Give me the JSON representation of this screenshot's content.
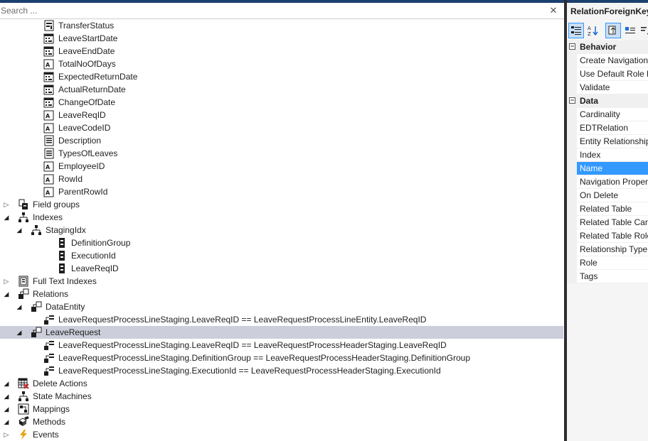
{
  "search": {
    "placeholder": "Search ...",
    "close_glyph": "✕"
  },
  "tree": {
    "fields": [
      "TransferStatus",
      "LeaveStartDate",
      "LeaveEndDate",
      "TotalNoOfDays",
      "ExpectedReturnDate",
      "ActualReturnDate",
      "ChangeOfDate",
      "LeaveReqID",
      "LeaveCodeID",
      "Description",
      "TypesOfLeaves",
      "EmployeeID",
      "RowId",
      "ParentRowId"
    ],
    "field_groups": "Field groups",
    "indexes": "Indexes",
    "staging_idx": "StagingIdx",
    "index_fields": [
      "DefinitionGroup",
      "ExecutionId",
      "LeaveReqID"
    ],
    "full_text_indexes": "Full Text Indexes",
    "relations": "Relations",
    "data_entity": "DataEntity",
    "data_entity_constraints": [
      "LeaveRequestProcessLineStaging.LeaveReqID == LeaveRequestProcessLineEntity.LeaveReqID"
    ],
    "leave_request": "LeaveRequest",
    "leave_request_constraints": [
      "LeaveRequestProcessLineStaging.LeaveReqID == LeaveRequestProcessHeaderStaging.LeaveReqID",
      "LeaveRequestProcessLineStaging.DefinitionGroup == LeaveRequestProcessHeaderStaging.DefinitionGroup",
      "LeaveRequestProcessLineStaging.ExecutionId == LeaveRequestProcessHeaderStaging.ExecutionId"
    ],
    "delete_actions": "Delete Actions",
    "state_machines": "State Machines",
    "mappings": "Mappings",
    "methods": "Methods",
    "events": "Events"
  },
  "properties": {
    "title": "RelationForeignKey",
    "categories": [
      {
        "name": "Behavior",
        "items": [
          "Create Navigation",
          "Use Default Role N",
          "Validate"
        ]
      },
      {
        "name": "Data",
        "items": [
          "Cardinality",
          "EDTRelation",
          "Entity Relationship",
          "Index",
          "Name",
          "Navigation Proper",
          "On Delete",
          "Related Table",
          "Related Table Card",
          "Related Table Role",
          "Relationship Type",
          "Role",
          "Tags"
        ]
      }
    ],
    "selected_item": "Name"
  },
  "colors": {
    "selection_tree": "#cccedb",
    "selection_prop": "#3399ff",
    "accent_dark": "#1c3f6e"
  }
}
